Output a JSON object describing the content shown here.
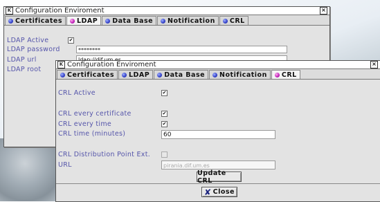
{
  "back_window": {
    "title": "Configuration Enviroment",
    "tabs": [
      "Certificates",
      "LDAP",
      "Data Base",
      "Notification",
      "CRL"
    ],
    "active_tab": "LDAP",
    "ldap_active_label": "LDAP Active",
    "ldap_active_checked": "✔",
    "ldap_password_label": "LDAP password",
    "ldap_password_value": "********",
    "ldap_url_label": "LDAP url",
    "ldap_url_value": "ldap://dif.um.es",
    "ldap_root_label": "LDAP root"
  },
  "front_window": {
    "title": "Configuration Enviroment",
    "tabs": [
      "Certificates",
      "LDAP",
      "Data Base",
      "Notification",
      "CRL"
    ],
    "active_tab": "CRL",
    "crl_active_label": "CRL Active",
    "crl_active_checked": "✔",
    "crl_every_certificate_label": "CRL every certificate",
    "crl_every_certificate_checked": "✔",
    "crl_every_time_label": "CRL every time",
    "crl_every_time_checked": "✔",
    "crl_time_label": "CRL time (minutes)",
    "crl_time_value": "60",
    "crl_dist_label": "CRL Distribution Point Ext.",
    "url_label": "URL",
    "url_value": "pirania.dif.um.es",
    "update_button": "Update CRL",
    "close_button": "Close"
  },
  "icons": {
    "close_glyph": "×",
    "close_button_icon": "✘",
    "k_logo": "K"
  }
}
